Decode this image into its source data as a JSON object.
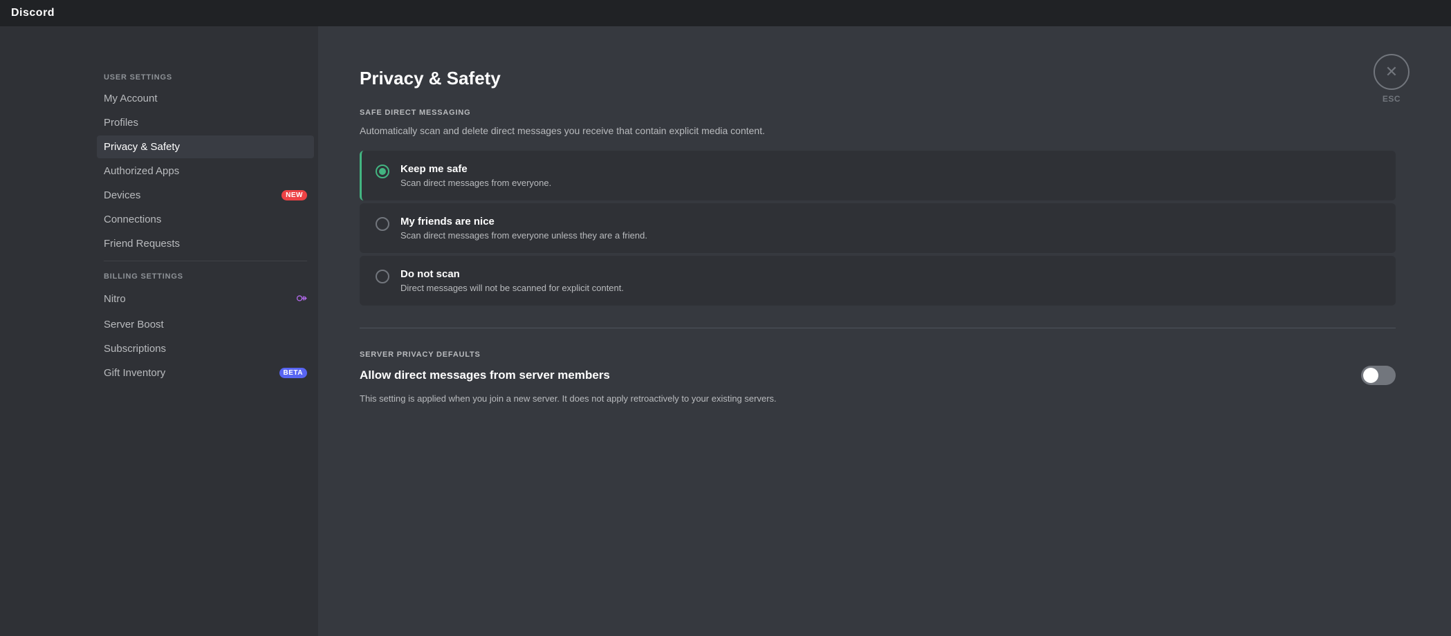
{
  "titleBar": {
    "appName": "Discord"
  },
  "sidebar": {
    "userSettingsLabel": "User Settings",
    "items": [
      {
        "id": "my-account",
        "label": "My Account",
        "badge": null,
        "active": false
      },
      {
        "id": "profiles",
        "label": "Profiles",
        "badge": null,
        "active": false
      },
      {
        "id": "privacy-safety",
        "label": "Privacy & Safety",
        "badge": null,
        "active": true
      },
      {
        "id": "authorized-apps",
        "label": "Authorized Apps",
        "badge": null,
        "active": false
      },
      {
        "id": "devices",
        "label": "Devices",
        "badge": "NEW",
        "badgeType": "new",
        "active": false
      },
      {
        "id": "connections",
        "label": "Connections",
        "badge": null,
        "active": false
      },
      {
        "id": "friend-requests",
        "label": "Friend Requests",
        "badge": null,
        "active": false
      }
    ],
    "billingSettingsLabel": "Billing Settings",
    "billingItems": [
      {
        "id": "nitro",
        "label": "Nitro",
        "badge": null,
        "icon": "nitro",
        "active": false
      },
      {
        "id": "server-boost",
        "label": "Server Boost",
        "badge": null,
        "active": false
      },
      {
        "id": "subscriptions",
        "label": "Subscriptions",
        "badge": null,
        "active": false
      },
      {
        "id": "gift-inventory",
        "label": "Gift Inventory",
        "badge": "BETA",
        "badgeType": "beta",
        "active": false
      }
    ]
  },
  "content": {
    "pageTitle": "Privacy & Safety",
    "closeLabel": "ESC",
    "safeDM": {
      "sectionHeader": "Safe Direct Messaging",
      "description": "Automatically scan and delete direct messages you receive that contain explicit media content.",
      "options": [
        {
          "id": "keep-me-safe",
          "title": "Keep me safe",
          "desc": "Scan direct messages from everyone.",
          "selected": true
        },
        {
          "id": "friends-nice",
          "title": "My friends are nice",
          "desc": "Scan direct messages from everyone unless they are a friend.",
          "selected": false
        },
        {
          "id": "do-not-scan",
          "title": "Do not scan",
          "desc": "Direct messages will not be scanned for explicit content.",
          "selected": false
        }
      ]
    },
    "serverPrivacy": {
      "sectionHeader": "Server Privacy Defaults",
      "toggleLabel": "Allow direct messages from server members",
      "toggleState": "off",
      "toggleDesc": "This setting is applied when you join a new server. It does not apply retroactively to your existing servers."
    }
  }
}
